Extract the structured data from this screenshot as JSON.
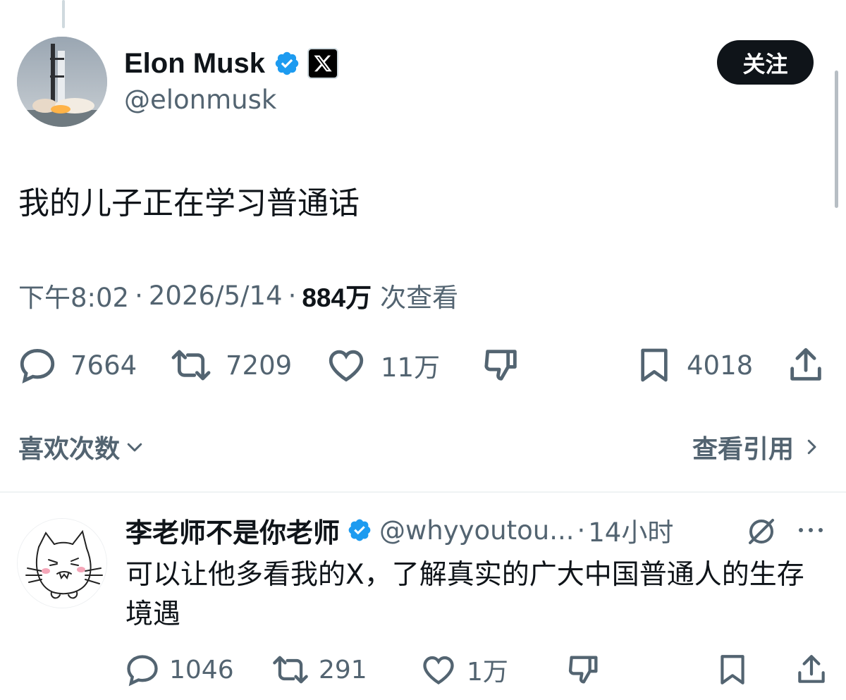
{
  "tweet": {
    "author_name": "Elon Musk",
    "author_handle": "@elonmusk",
    "follow_label": "关注",
    "text": "我的儿子正在学习普通话",
    "time": "下午8:02",
    "date": "2026/5/14",
    "separator": "·",
    "views_count": "884万",
    "views_label": "次查看",
    "stats": {
      "replies": "7664",
      "retweets": "7209",
      "likes": "11万",
      "bookmarks": "4018"
    },
    "likes_link_label": "喜欢次数",
    "quotes_link_label": "查看引用"
  },
  "reply": {
    "author_name": "李老师不是你老师",
    "author_handle": "@whyyoutou...",
    "time_separator": "·",
    "time": "14小时",
    "text": "可以让他多看我的X，了解真实的广大中国普通人的生存境遇",
    "stats": {
      "replies": "1046",
      "retweets": "291",
      "likes": "1万"
    }
  },
  "colors": {
    "verified_blue": "#1d9bf0",
    "text_primary": "#0f1419",
    "text_secondary": "#536471",
    "follow_button_bg": "#0f1419"
  },
  "icons": [
    "verified-icon",
    "x-logo-icon",
    "reply-icon",
    "retweet-icon",
    "like-icon",
    "dislike-icon",
    "bookmark-icon",
    "share-icon",
    "chevron-down-icon",
    "chevron-right-icon",
    "grok-icon",
    "more-icon"
  ]
}
